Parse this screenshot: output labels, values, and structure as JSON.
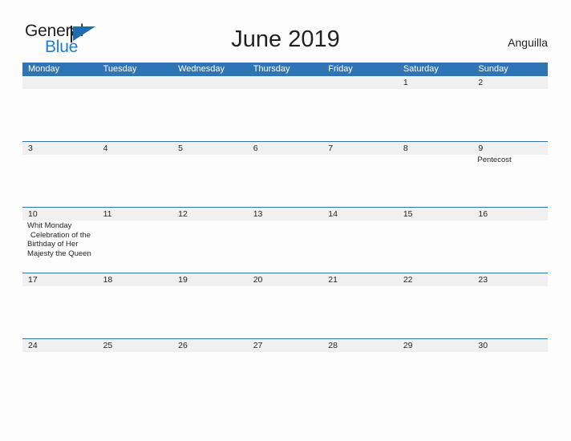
{
  "logo": {
    "word_top": "General",
    "word_bottom": "Blue",
    "icon": "flag-triangle-icon",
    "color_blue": "#1b7ed6",
    "color_flag": "#1b6cb0",
    "color_dark": "#231f20"
  },
  "header": {
    "title": "June 2019",
    "region": "Anguilla"
  },
  "theme": {
    "header_blue": "#2e75b6",
    "date_band_gray": "#f0f0f0",
    "page_background": "#fdfdfd",
    "text": "#231f20"
  },
  "calendar": {
    "month": "June",
    "year": "2019",
    "weekday_headers": [
      "Monday",
      "Tuesday",
      "Wednesday",
      "Thursday",
      "Friday",
      "Saturday",
      "Sunday"
    ],
    "weeks": [
      {
        "days": [
          {
            "date": "",
            "events": []
          },
          {
            "date": "",
            "events": []
          },
          {
            "date": "",
            "events": []
          },
          {
            "date": "",
            "events": []
          },
          {
            "date": "",
            "events": []
          },
          {
            "date": "1",
            "events": []
          },
          {
            "date": "2",
            "events": []
          }
        ]
      },
      {
        "days": [
          {
            "date": "3",
            "events": []
          },
          {
            "date": "4",
            "events": []
          },
          {
            "date": "5",
            "events": []
          },
          {
            "date": "6",
            "events": []
          },
          {
            "date": "7",
            "events": []
          },
          {
            "date": "8",
            "events": []
          },
          {
            "date": "9",
            "events": [
              "Pentecost"
            ]
          }
        ]
      },
      {
        "days": [
          {
            "date": "10",
            "events": [
              "Whit Monday",
              "Celebration of the Birthday of Her Majesty the Queen"
            ]
          },
          {
            "date": "11",
            "events": []
          },
          {
            "date": "12",
            "events": []
          },
          {
            "date": "13",
            "events": []
          },
          {
            "date": "14",
            "events": []
          },
          {
            "date": "15",
            "events": []
          },
          {
            "date": "16",
            "events": []
          }
        ]
      },
      {
        "days": [
          {
            "date": "17",
            "events": []
          },
          {
            "date": "18",
            "events": []
          },
          {
            "date": "19",
            "events": []
          },
          {
            "date": "20",
            "events": []
          },
          {
            "date": "21",
            "events": []
          },
          {
            "date": "22",
            "events": []
          },
          {
            "date": "23",
            "events": []
          }
        ]
      },
      {
        "days": [
          {
            "date": "24",
            "events": []
          },
          {
            "date": "25",
            "events": []
          },
          {
            "date": "26",
            "events": []
          },
          {
            "date": "27",
            "events": []
          },
          {
            "date": "28",
            "events": []
          },
          {
            "date": "29",
            "events": []
          },
          {
            "date": "30",
            "events": []
          }
        ]
      }
    ]
  }
}
